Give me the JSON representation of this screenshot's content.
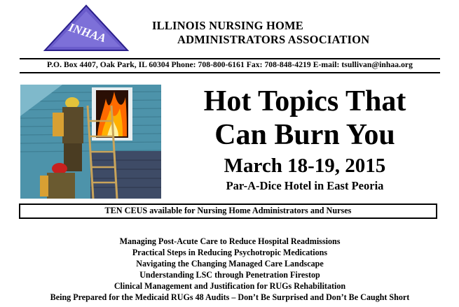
{
  "logo": {
    "text": "INHAA"
  },
  "organization": {
    "line1": "ILLINOIS NURSING HOME",
    "line2": "ADMINISTRATORS ASSOCIATION"
  },
  "contact": "P.O. Box 4407, Oak Park, IL 60304 Phone: 708-800-6161 Fax: 708-848-4219 E-mail: tsullivan@inhaa.org",
  "event": {
    "title_line1": "Hot Topics That",
    "title_line2": "Can Burn You",
    "date": "March 18-19, 2015",
    "venue": "Par-A-Dice Hotel in East Peoria"
  },
  "ceus": "TEN CEUS available for Nursing Home Administrators and Nurses",
  "topics": [
    "Managing Post-Acute Care to Reduce Hospital Readmissions",
    "Practical Steps in Reducing Psychotropic Medications",
    "Navigating the Changing Managed Care Landscape",
    "Understanding LSC through Penetration Firestop",
    "Clinical Management and Justification for RUGs Rehabilitation",
    "Being Prepared for the Medicaid RUGs 48 Audits – Don’t Be Surprised and Don’t Be Caught Short"
  ],
  "colors": {
    "logo_fill": "#6a5ccb",
    "logo_stroke": "#2a1f8a",
    "house_siding": "#5fa3b8",
    "fire": "#ff6a00",
    "rule": "#000000"
  },
  "icons": {
    "logo": "triangle-logo",
    "photo": "firefighters-photo"
  }
}
